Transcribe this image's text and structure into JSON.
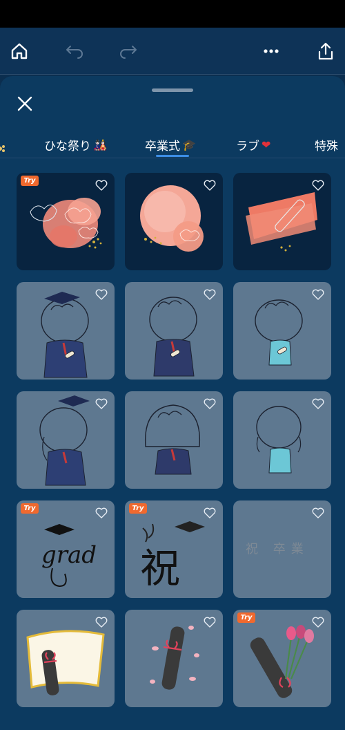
{
  "toolbar": {
    "icons": [
      "home-icon",
      "undo-icon",
      "redo-icon",
      "more-icon",
      "share-icon"
    ]
  },
  "sheet": {
    "close_icon": "close-icon"
  },
  "tabs": [
    {
      "label": "ひな祭り",
      "emoji": "🎎"
    },
    {
      "label": "卒業式",
      "emoji": "🎓",
      "active": true
    },
    {
      "label": "ラブ",
      "emoji": "❤️"
    },
    {
      "label": "特殊",
      "emoji": ""
    }
  ],
  "badge": {
    "try_label": "Try"
  },
  "stickers": [
    {
      "name": "watercolor-flower-pink",
      "style": "dark",
      "try": true
    },
    {
      "name": "watercolor-blob-flower",
      "style": "dark",
      "try": false
    },
    {
      "name": "watercolor-stroke-diploma",
      "style": "dark",
      "try": false
    },
    {
      "name": "boy-graduate-cap",
      "style": "light",
      "try": false
    },
    {
      "name": "boy-navy-suit",
      "style": "light",
      "try": false
    },
    {
      "name": "boy-blue-suit",
      "style": "light",
      "try": false
    },
    {
      "name": "girl-graduate-cap",
      "style": "light",
      "try": false
    },
    {
      "name": "girl-navy-suit",
      "style": "light",
      "try": false
    },
    {
      "name": "girl-blue-suit",
      "style": "light",
      "try": false
    },
    {
      "name": "grad-lettering",
      "style": "light",
      "try": true,
      "text": "grad"
    },
    {
      "name": "iwai-calligraphy",
      "style": "light",
      "try": true,
      "text": "祝"
    },
    {
      "name": "iwai-sotsugyou-text",
      "style": "light",
      "try": false,
      "text": "祝 卒業"
    },
    {
      "name": "certificate-scroll",
      "style": "light",
      "try": false
    },
    {
      "name": "diploma-petals",
      "style": "light",
      "try": false
    },
    {
      "name": "diploma-tulips",
      "style": "light",
      "try": true
    }
  ],
  "colors": {
    "accent": "#3d8ee6",
    "try_badge": "#f0692e",
    "card_light": "#5e7890",
    "card_dark": "#082440",
    "sheet": "#0c3a60"
  }
}
